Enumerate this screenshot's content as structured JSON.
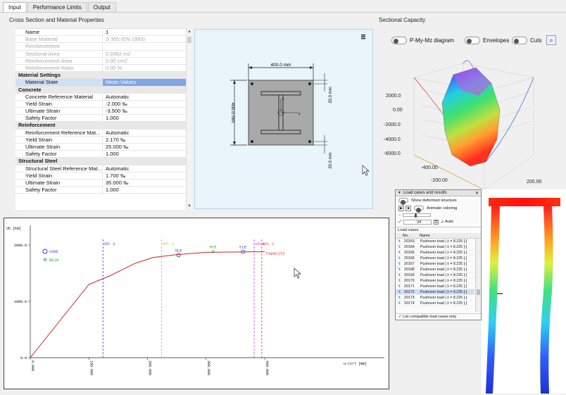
{
  "tabs": [
    "Input",
    "Performance Limits",
    "Output"
  ],
  "left_title": "Cross Section and Material Properties",
  "right_title": "Sectional Capacity",
  "props": [
    {
      "k": "row",
      "name": "Name",
      "value": "1"
    },
    {
      "k": "dis",
      "name": "Base Material",
      "value": "S 355 (EN 1993)"
    },
    {
      "k": "dis",
      "name": "Reinforcement",
      "value": ""
    },
    {
      "k": "dis",
      "name": "Sectional Area",
      "value": "0.0362 m2"
    },
    {
      "k": "dis",
      "name": "Reinforcement Area",
      "value": "0.00 cm2"
    },
    {
      "k": "dis",
      "name": "Reinforcement Ratio",
      "value": "0.00 %"
    },
    {
      "k": "hdr",
      "name": "Material Settings",
      "value": ""
    },
    {
      "k": "sel",
      "name": "Material State",
      "value": "Mean Values"
    },
    {
      "k": "hdr",
      "name": "Concrete",
      "value": ""
    },
    {
      "k": "row",
      "name": "Concrete Reference Material",
      "value": "Automatic"
    },
    {
      "k": "row",
      "name": "Yield Strain",
      "value": "-2.000 ‰"
    },
    {
      "k": "row",
      "name": "Ultimate Strain",
      "value": "-3.500 ‰"
    },
    {
      "k": "row",
      "name": "Safety Factor",
      "value": "1.000"
    },
    {
      "k": "hdr",
      "name": "Reinforcement",
      "value": ""
    },
    {
      "k": "row",
      "name": "Reinforcement Reference Mat...",
      "value": "Automatic"
    },
    {
      "k": "row",
      "name": "Yield Strain",
      "value": "2.170 ‰"
    },
    {
      "k": "row",
      "name": "Ultimate Strain",
      "value": "25.000 ‰"
    },
    {
      "k": "row",
      "name": "Safety Factor",
      "value": "1.000"
    },
    {
      "k": "hdr",
      "name": "Structural Steel",
      "value": ""
    },
    {
      "k": "row",
      "name": "Structural Steel Reference Mat...",
      "value": "Automatic"
    },
    {
      "k": "row",
      "name": "Yield Strain",
      "value": "1.700 ‰"
    },
    {
      "k": "row",
      "name": "Ultimate Strain",
      "value": "35.000 ‰"
    },
    {
      "k": "row",
      "name": "Safety Factor",
      "value": "1.000"
    }
  ],
  "section": {
    "menu_icon": "hamburger-icon",
    "dim_width": "400.0 mm",
    "dim_height": "400.0 mm",
    "dim_cover_top": "20.0 mm",
    "dim_cover_bottom": "20.0 mm",
    "axis_z": "z",
    "axis_y": "y"
  },
  "capacity": {
    "toggles": [
      "P-My-Mz diagram",
      "Envelopes",
      "Cuts"
    ],
    "zoom_icon": "zoom-icon",
    "z_ticks": [
      "2000.0",
      "0.00",
      "-2000.0",
      "-4000.0",
      "-6000.0"
    ],
    "x_ticks": [
      "-400.00",
      "-200.00"
    ],
    "y_tick": "200.00"
  },
  "chart_data": {
    "type": "line",
    "ylabel": "Vb [kN]",
    "xlabel": "u-ctrl [mm]",
    "x_ticks": [
      "0.000",
      "100.000",
      "200.000",
      "300.000",
      "400.000"
    ],
    "y_ticks": [
      "0.0",
      "1000.0",
      "2000.0"
    ],
    "xlim": [
      0,
      460
    ],
    "ylim": [
      0,
      2350
    ],
    "series": [
      {
        "name": "Capacity",
        "x": [
          0,
          100,
          135,
          180,
          210,
          250,
          300,
          380,
          400
        ],
        "y": [
          0,
          1300,
          1450,
          1680,
          1780,
          1830,
          1870,
          1880,
          1880
        ]
      }
    ],
    "vlines": [
      {
        "label": "SPL 2",
        "x": 124,
        "color": "#3a3ad6"
      },
      {
        "label": "SPL 3",
        "x": 224,
        "color": "#c8c030"
      },
      {
        "label": "SPL4",
        "x": 382,
        "color": "#d23cd2"
      },
      {
        "label": "SPL 1",
        "x": 395,
        "color": "#d63a3a"
      }
    ],
    "markers": [
      {
        "label": "OLE",
        "x": 253,
        "y": 1820,
        "symbol": "circle",
        "color": "#3333aa"
      },
      {
        "label": "OCE",
        "x": 312,
        "y": 1880,
        "symbol": "star",
        "color": "#22aa22"
      },
      {
        "label": "CLE",
        "x": 363,
        "y": 1880,
        "symbol": "circle",
        "color": "#3333aa"
      }
    ],
    "legend": [
      {
        "label": "CONC",
        "symbol": "circle",
        "color": "#3333cc"
      },
      {
        "label": "REIN",
        "symbol": "star",
        "color": "#22aa22"
      }
    ],
    "series_label": "Capacity",
    "colors": {
      "line": "#cc2222"
    }
  },
  "loadcases": {
    "title": "Load cases and results",
    "show_deformed": "Show deformed structure",
    "animate": "Animate coloring",
    "frame": "34",
    "auto": "Auto",
    "section": "Load cases",
    "col_no": "No.",
    "col_name": "Name",
    "rows": [
      {
        "no": "20163",
        "name": "Pushover load | λ = 8.225 [-]"
      },
      {
        "no": "20164",
        "name": "Pushover load | λ = 8.225 [-]"
      },
      {
        "no": "20165",
        "name": "Pushover load | λ = 8.225 [-]"
      },
      {
        "no": "20166",
        "name": "Pushover load | λ = 8.225 [-]"
      },
      {
        "no": "20167",
        "name": "Pushover load | λ = 8.225 [-]"
      },
      {
        "no": "20168",
        "name": "Pushover load | λ = 8.225 [-]"
      },
      {
        "no": "20169",
        "name": "Pushover load | λ = 8.225 [-]"
      },
      {
        "no": "20170",
        "name": "Pushover load | λ = 8.225 [-]"
      },
      {
        "no": "20171",
        "name": "Pushover load | λ = 8.225 [-]"
      },
      {
        "no": "20172",
        "name": "Pushover load | λ = 8.225 [-]"
      },
      {
        "no": "20173",
        "name": "Pushover load | λ = 8.225 [-]"
      },
      {
        "no": "20174",
        "name": "Pushover load | λ = 8.225 [-]"
      }
    ],
    "selected_index": 9,
    "footer": "List compatible load cases only"
  }
}
